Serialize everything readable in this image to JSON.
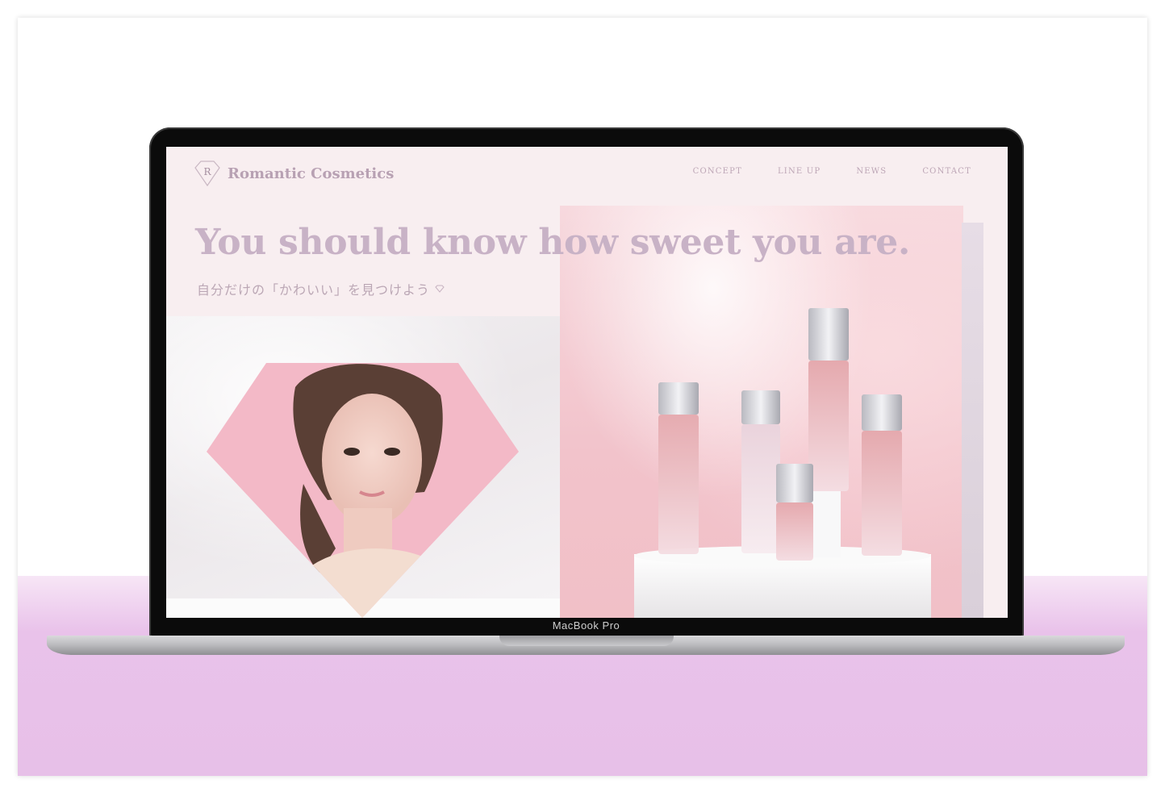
{
  "device": {
    "label": "MacBook Pro"
  },
  "site": {
    "brand": "Romantic Cosmetics",
    "nav": [
      "CONCEPT",
      "LINE UP",
      "NEWS",
      "CONTACT"
    ],
    "headline": "You should know how sweet you are.",
    "subheadline": "自分だけの「かわいい」を見つけよう"
  },
  "colors": {
    "brand_text": "#b8a1b3",
    "headline": "#c8b2c6",
    "accent_pink": "#f2c3cb",
    "floor": "#e7c0e8"
  },
  "icons": [
    "diamond-logo-icon",
    "diamond-small-icon"
  ]
}
